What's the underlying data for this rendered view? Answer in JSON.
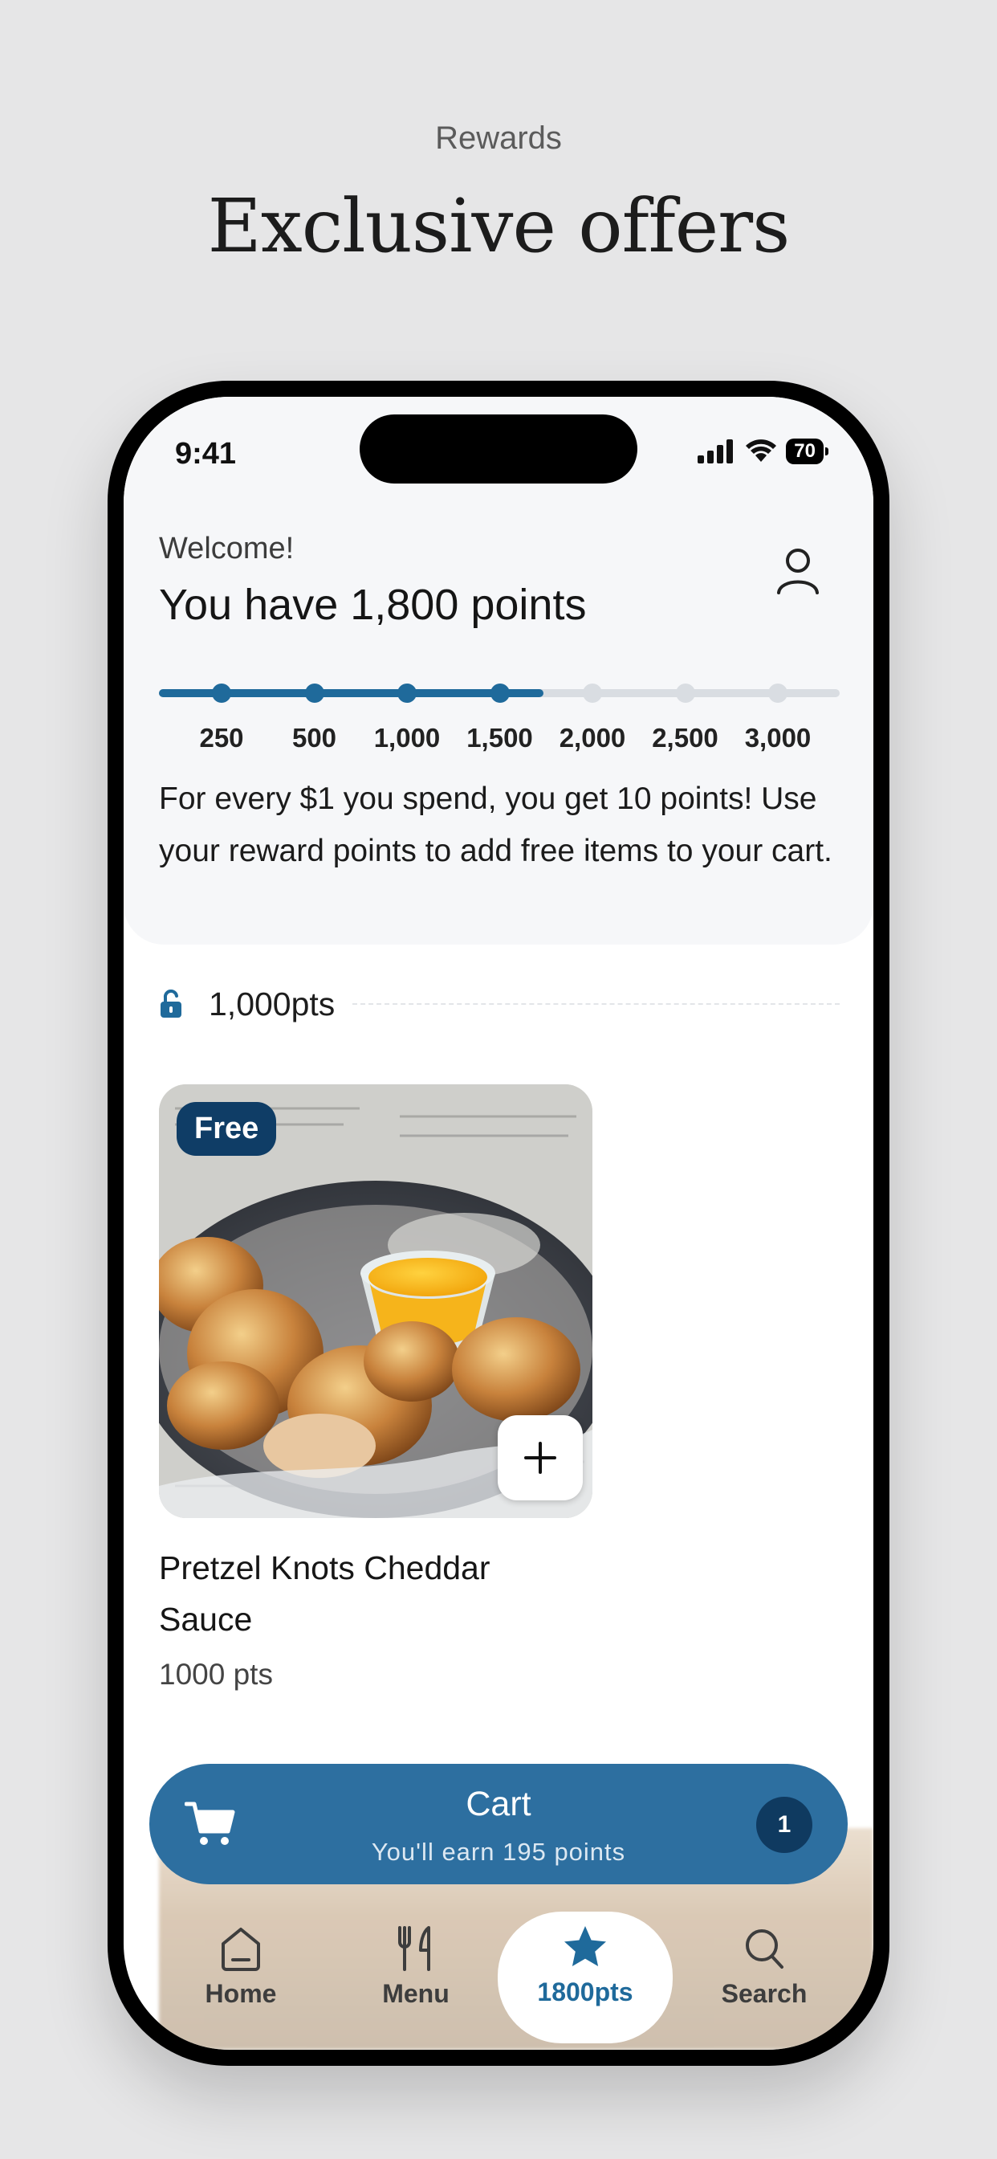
{
  "promo": {
    "eyebrow": "Rewards",
    "headline": "Exclusive offers"
  },
  "status_bar": {
    "time": "9:41",
    "battery": "70"
  },
  "header": {
    "welcome": "Welcome!",
    "points_title": "You have 1,800 points",
    "info_text": "For every $1 you spend, you get 10 points! Use your reward points to add free items to your cart."
  },
  "progress": {
    "current_points": 1800,
    "max_points": 3000,
    "ticks": [
      "250",
      "500",
      "1,000",
      "1,500",
      "2,000",
      "2,500",
      "3,000"
    ],
    "reached": [
      true,
      true,
      true,
      true,
      false,
      false,
      false
    ]
  },
  "section": {
    "label": "1,000pts",
    "icon": "unlock-icon"
  },
  "product": {
    "badge": "Free",
    "name": "Pretzel Knots Cheddar Sauce",
    "points": "1000 pts"
  },
  "cart": {
    "title": "Cart",
    "subtitle": "You'll earn 195 points",
    "count": "1"
  },
  "tabs": [
    {
      "label": "Home",
      "icon": "home-icon",
      "active": false
    },
    {
      "label": "Menu",
      "icon": "utensils-icon",
      "active": false
    },
    {
      "label": "1800pts",
      "icon": "star-icon",
      "active": true
    },
    {
      "label": "Search",
      "icon": "search-icon",
      "active": false
    }
  ],
  "colors": {
    "accent": "#1f6a9b",
    "cart_bar": "#2d6fa0",
    "badge": "#0f3d66",
    "track": "#d9dde2"
  }
}
